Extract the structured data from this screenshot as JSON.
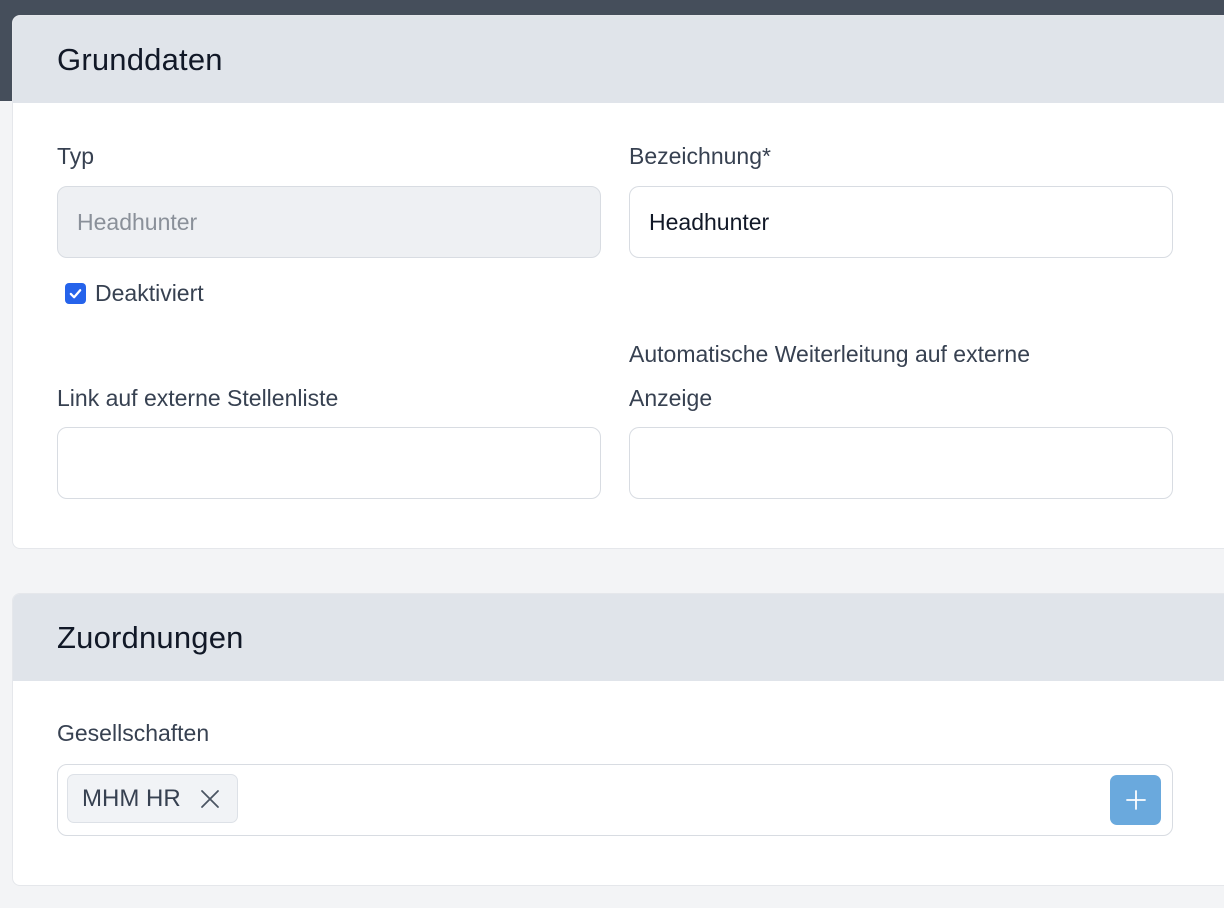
{
  "grunddaten": {
    "title": "Grunddaten",
    "typ_label": "Typ",
    "typ_value": "Headhunter",
    "bezeichnung_label": "Bezeichnung*",
    "bezeichnung_value": "Headhunter",
    "deaktiviert_label": "Deaktiviert",
    "deaktiviert_checked": true,
    "link_label": "Link auf externe Stellenliste",
    "link_value": "",
    "weiterleitung_label_line1": "Automatische Weiterleitung auf externe",
    "weiterleitung_label_line2": "Anzeige",
    "weiterleitung_value": ""
  },
  "zuordnungen": {
    "title": "Zuordnungen",
    "gesellschaften_label": "Gesellschaften",
    "tags": [
      "MHM HR"
    ]
  },
  "icons": {
    "checkbox": "check-icon",
    "tag_remove": "close-icon",
    "add": "plus-icon"
  },
  "colors": {
    "accent": "#2563eb",
    "add_button": "#6aa9dd",
    "header_bg": "#e0e4ea",
    "topbar": "#454e5b"
  }
}
